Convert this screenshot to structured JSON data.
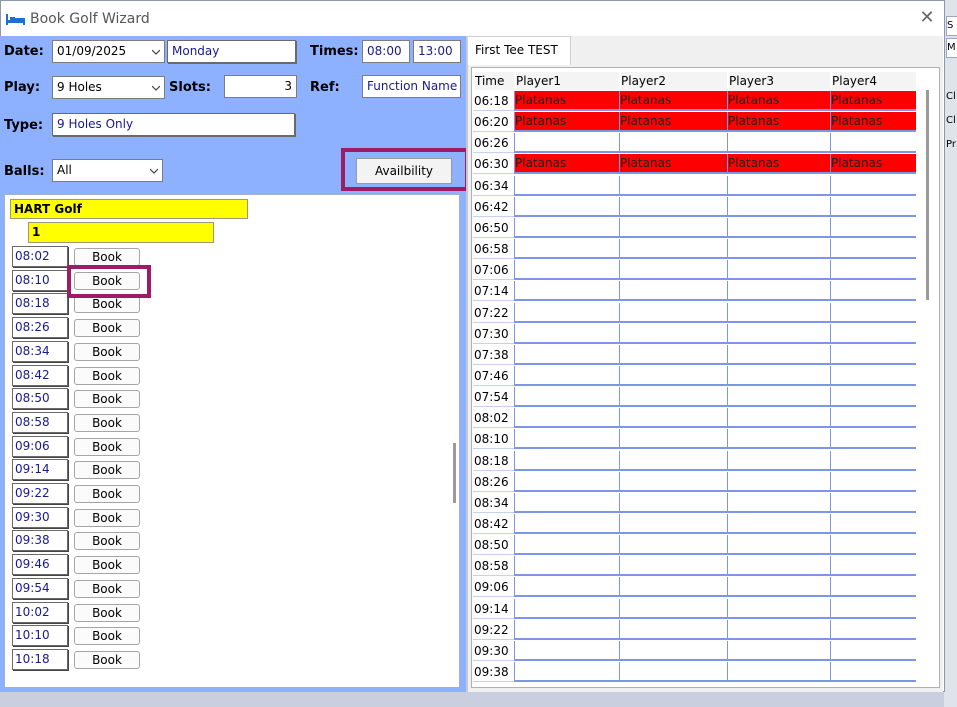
{
  "window": {
    "title": "Book Golf Wizard",
    "close": "✕"
  },
  "form": {
    "date_label": "Date:",
    "date_value": "01/09/2025",
    "day": "Monday",
    "times_label": "Times:",
    "time_from": "08:00",
    "time_to": "13:00",
    "play_label": "Play:",
    "play_value": "9 Holes",
    "slots_label": "Slots:",
    "slots_value": "3",
    "ref_label": "Ref:",
    "ref_value": "Function Name",
    "type_label": "Type:",
    "type_value": "9 Holes Only",
    "balls_label": "Balls:",
    "balls_value": "All",
    "availability_button": "Availbility"
  },
  "tree": {
    "course": "HART Golf",
    "tee": "1",
    "book_label": "Book",
    "slots": [
      "08:02",
      "08:10",
      "08:18",
      "08:26",
      "08:34",
      "08:42",
      "08:50",
      "08:58",
      "09:06",
      "09:14",
      "09:22",
      "09:30",
      "09:38",
      "09:46",
      "09:54",
      "10:02",
      "10:10",
      "10:18"
    ]
  },
  "tee_sheet": {
    "tab": "First Tee TEST",
    "columns": [
      "Time",
      "Player1",
      "Player2",
      "Player3",
      "Player4"
    ],
    "rows": [
      {
        "time": "06:18",
        "players": [
          "Platanas",
          "Platanas",
          "Platanas",
          "Platanas"
        ]
      },
      {
        "time": "06:20",
        "players": [
          "Platanas",
          "Platanas",
          "Platanas",
          "Platanas"
        ]
      },
      {
        "time": "06:26",
        "players": [
          "",
          "",
          "",
          ""
        ]
      },
      {
        "time": "06:30",
        "players": [
          "Platanas",
          "Platanas",
          "Platanas",
          "Platanas"
        ]
      },
      {
        "time": "06:34",
        "players": [
          "",
          "",
          "",
          ""
        ]
      },
      {
        "time": "06:42",
        "players": [
          "",
          "",
          "",
          ""
        ]
      },
      {
        "time": "06:50",
        "players": [
          "",
          "",
          "",
          ""
        ]
      },
      {
        "time": "06:58",
        "players": [
          "",
          "",
          "",
          ""
        ]
      },
      {
        "time": "07:06",
        "players": [
          "",
          "",
          "",
          ""
        ]
      },
      {
        "time": "07:14",
        "players": [
          "",
          "",
          "",
          ""
        ]
      },
      {
        "time": "07:22",
        "players": [
          "",
          "",
          "",
          ""
        ]
      },
      {
        "time": "07:30",
        "players": [
          "",
          "",
          "",
          ""
        ]
      },
      {
        "time": "07:38",
        "players": [
          "",
          "",
          "",
          ""
        ]
      },
      {
        "time": "07:46",
        "players": [
          "",
          "",
          "",
          ""
        ]
      },
      {
        "time": "07:54",
        "players": [
          "",
          "",
          "",
          ""
        ]
      },
      {
        "time": "08:02",
        "players": [
          "",
          "",
          "",
          ""
        ]
      },
      {
        "time": "08:10",
        "players": [
          "",
          "",
          "",
          ""
        ]
      },
      {
        "time": "08:18",
        "players": [
          "",
          "",
          "",
          ""
        ]
      },
      {
        "time": "08:26",
        "players": [
          "",
          "",
          "",
          ""
        ]
      },
      {
        "time": "08:34",
        "players": [
          "",
          "",
          "",
          ""
        ]
      },
      {
        "time": "08:42",
        "players": [
          "",
          "",
          "",
          ""
        ]
      },
      {
        "time": "08:50",
        "players": [
          "",
          "",
          "",
          ""
        ]
      },
      {
        "time": "08:58",
        "players": [
          "",
          "",
          "",
          ""
        ]
      },
      {
        "time": "09:06",
        "players": [
          "",
          "",
          "",
          ""
        ]
      },
      {
        "time": "09:14",
        "players": [
          "",
          "",
          "",
          ""
        ]
      },
      {
        "time": "09:22",
        "players": [
          "",
          "",
          "",
          ""
        ]
      },
      {
        "time": "09:30",
        "players": [
          "",
          "",
          "",
          ""
        ]
      },
      {
        "time": "09:38",
        "players": [
          "",
          "",
          "",
          ""
        ]
      }
    ]
  },
  "colors": {
    "panel": "#8eb1ff",
    "booked": "#ff0000",
    "highlight": "#9e1b68",
    "tree_header": "#ffff00"
  },
  "background_fragments": [
    "S",
    "M",
    "Cl",
    "Cl",
    "Pr"
  ]
}
